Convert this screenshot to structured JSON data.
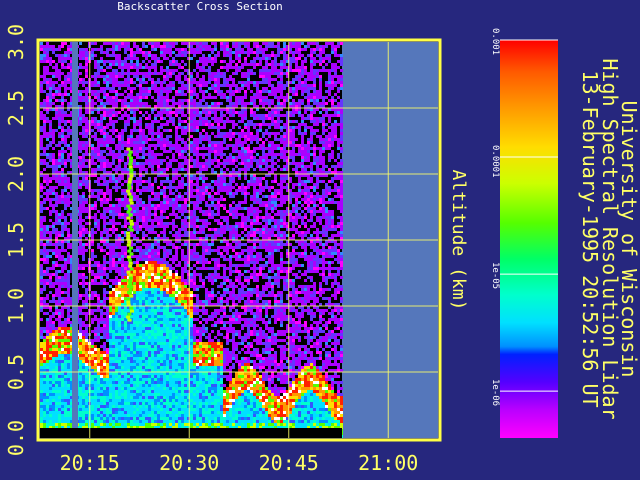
{
  "chart_data": {
    "type": "heatmap",
    "title": "Backscatter Cross Section",
    "ylabel": "Altitude (km)",
    "ylim": [
      0.0,
      3.0
    ],
    "y_ticks": [
      "0.0",
      "0.5",
      "1.0",
      "1.5",
      "2.0",
      "2.5",
      "3.0"
    ],
    "x_ticks": [
      "20:15",
      "20:30",
      "20:45",
      "21:00"
    ],
    "colorbar": {
      "scale": "log",
      "ticks": [
        "0.001",
        "0.0001",
        "1e-05",
        "1e-06"
      ]
    },
    "side_title": [
      "University of Wisconsin",
      "High Spectral Resolution Lidar",
      "13-February-1995 20:52:56 UT"
    ]
  },
  "colors": {
    "background": "#26277e",
    "frame": "#ffff44",
    "no_data": "#5577bb",
    "grid": "#ffff66"
  }
}
